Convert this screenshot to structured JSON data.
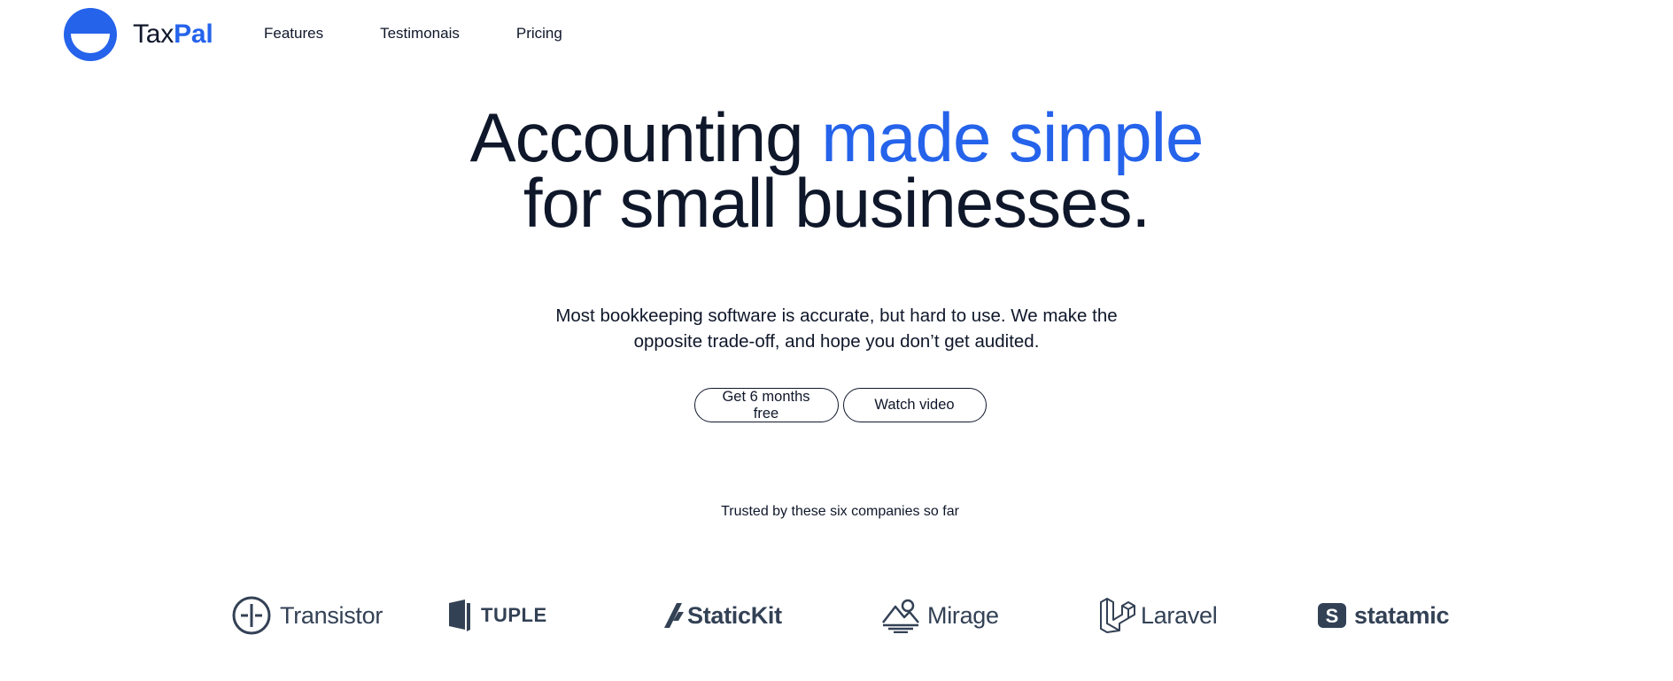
{
  "brand": {
    "name_part1": "Tax",
    "name_part2": "Pal",
    "accent_color": "#2563eb"
  },
  "nav": {
    "items": [
      {
        "label": "Features"
      },
      {
        "label": "Testimonais"
      },
      {
        "label": "Pricing"
      }
    ]
  },
  "hero": {
    "title_part1": "Accounting ",
    "title_highlight": "made simple",
    "title_part2": "for small businesses.",
    "subtitle_line1": "Most bookkeeping software is accurate, but hard to use. We make the",
    "subtitle_line2": "opposite trade-off, and hope you don’t get audited.",
    "primary_cta": "Get 6 months free",
    "secondary_cta": "Watch video"
  },
  "trusted": {
    "label": "Trusted by these six companies so far",
    "companies": [
      {
        "name": "Transistor",
        "icon": "transistor-icon"
      },
      {
        "name": "TUPLE",
        "icon": "tuple-icon"
      },
      {
        "name": "StaticKit",
        "icon": "statickit-icon"
      },
      {
        "name": "Mirage",
        "icon": "mirage-icon"
      },
      {
        "name": "Laravel",
        "icon": "laravel-icon"
      },
      {
        "name": "statamic",
        "icon": "statamic-icon"
      }
    ]
  }
}
